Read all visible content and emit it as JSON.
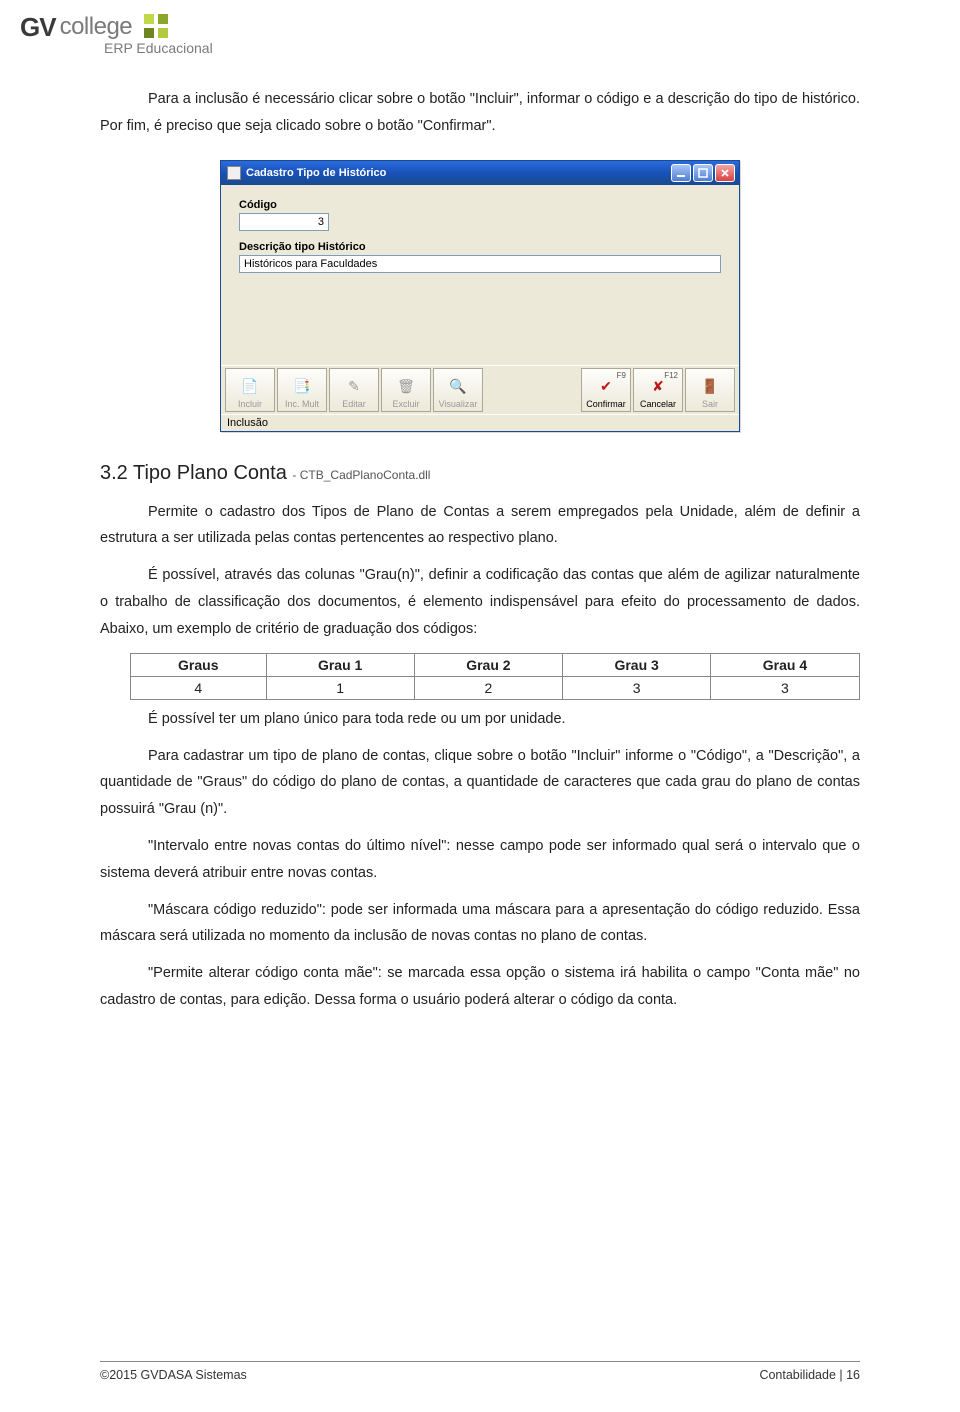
{
  "header": {
    "logo_gv": "GV",
    "logo_college": "college",
    "logo_sub": "ERP Educacional"
  },
  "intro_para": "Para a inclusão é necessário clicar sobre o botão \"Incluir\", informar o código e a descrição do tipo de histórico. Por fim, é preciso que seja clicado sobre o botão \"Confirmar\".",
  "win": {
    "title": "Cadastro Tipo de Histórico",
    "codigo_label": "Código",
    "codigo_value": "3",
    "desc_label": "Descrição tipo Histórico",
    "desc_value": "Históricos para Faculdades",
    "toolbar": {
      "incluir": "Incluir",
      "inc_mult": "Inc. Mult",
      "editar": "Editar",
      "excluir": "Excluir",
      "visualizar": "Visualizar",
      "confirmar": "Confirmar",
      "confirmar_fk": "F9",
      "cancelar": "Cancelar",
      "cancelar_fk": "F12",
      "sair": "Sair"
    },
    "status": "Inclusão"
  },
  "section": {
    "number": "3.2",
    "title": "Tipo Plano Conta",
    "dll": "CTB_CadPlanoConta.dll"
  },
  "p1": "Permite o cadastro dos Tipos de Plano de Contas a serem empregados pela Unidade, além de definir a estrutura a ser utilizada pelas contas pertencentes ao respectivo plano.",
  "p2": "É possível, através das colunas \"Grau(n)\", definir a codificação das contas que além de agilizar naturalmente o trabalho de classificação dos documentos, é elemento indispensável para efeito do processamento de dados. Abaixo, um exemplo de critério de graduação dos códigos:",
  "chart_data": {
    "type": "table",
    "headers": [
      "Graus",
      "Grau 1",
      "Grau 2",
      "Grau 3",
      "Grau 4"
    ],
    "row": [
      "4",
      "1",
      "2",
      "3",
      "3"
    ]
  },
  "p3": "É possível ter um plano único para toda rede ou um por unidade.",
  "p4": "Para cadastrar um tipo de plano de contas, clique sobre o botão \"Incluir\" informe o \"Código\", a \"Descrição\", a quantidade de \"Graus\" do código do plano de contas, a quantidade de caracteres que cada grau do plano de contas possuirá \"Grau (n)\".",
  "p5": "\"Intervalo entre novas contas do último nível\": nesse campo pode ser informado qual será o intervalo que o sistema deverá atribuir entre novas contas.",
  "p6": "\"Máscara código reduzido\": pode ser informada uma máscara para a apresentação do código reduzido. Essa máscara será utilizada no momento da inclusão de novas contas no plano de contas.",
  "p7": "\"Permite alterar código conta mãe\": se marcada essa opção o sistema irá habilita o campo \"Conta mãe\" no cadastro de contas, para edição. Dessa forma o usuário poderá alterar o código da conta.",
  "footer": {
    "left": "©2015 GVDASA Sistemas",
    "right": "Contabilidade | 16"
  }
}
